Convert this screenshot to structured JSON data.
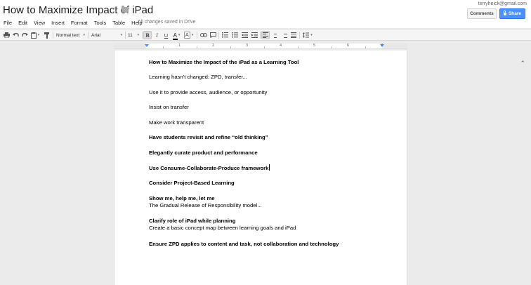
{
  "header": {
    "title": "How to Maximize Impact of iPad",
    "user_email": "terryheick@gmail.com",
    "comments_label": "Comments",
    "share_label": "Share",
    "save_status": "All changes saved in Drive"
  },
  "menu": [
    "File",
    "Edit",
    "View",
    "Insert",
    "Format",
    "Tools",
    "Table",
    "Help"
  ],
  "toolbar": {
    "style": "Normal text",
    "font": "Arial",
    "font_size": "11",
    "bold": "B",
    "italic": "I",
    "underline": "U",
    "text_color": "A",
    "highlight": "A",
    "more": "•"
  },
  "ruler": {
    "numbers": [
      "1",
      "2",
      "3",
      "4",
      "5",
      "6",
      "7"
    ]
  },
  "document": {
    "paragraphs": [
      {
        "text": "How to Maximize the Impact of the iPad as a Learning Tool",
        "bold": true
      },
      {
        "text": "Learning hasn't changed: ZPD, transfer...",
        "bold": false
      },
      {
        "text": "Use it to provide access, audience, or opportunity",
        "bold": false
      },
      {
        "text": "Insist on transfer",
        "bold": false
      },
      {
        "text": "Make work transparent",
        "bold": false
      },
      {
        "text": "Have students revisit and refine “old thinking”",
        "bold": true
      },
      {
        "text": "Elegantly curate product and performance",
        "bold": true
      },
      {
        "text": "Use Consume-Collaborate-Produce framework",
        "bold": true
      },
      {
        "text": "Consider Project-Based Learning",
        "bold": true
      },
      {
        "text": "Show me, help me, let me",
        "bold": true,
        "sub": "The Gradual Release of Responsibility model..."
      },
      {
        "text": "Clarify role of iPad while planning",
        "bold": true,
        "sub": "Create a basic concept map between learning goals and iPad"
      },
      {
        "text": "Ensure ZPD applies to content and task, not collaboration and technology",
        "bold": true
      }
    ]
  },
  "colors": {
    "accent": "#4d90fe",
    "toolbar_bg": "#f5f5f5",
    "canvas_bg": "#ebebeb"
  }
}
